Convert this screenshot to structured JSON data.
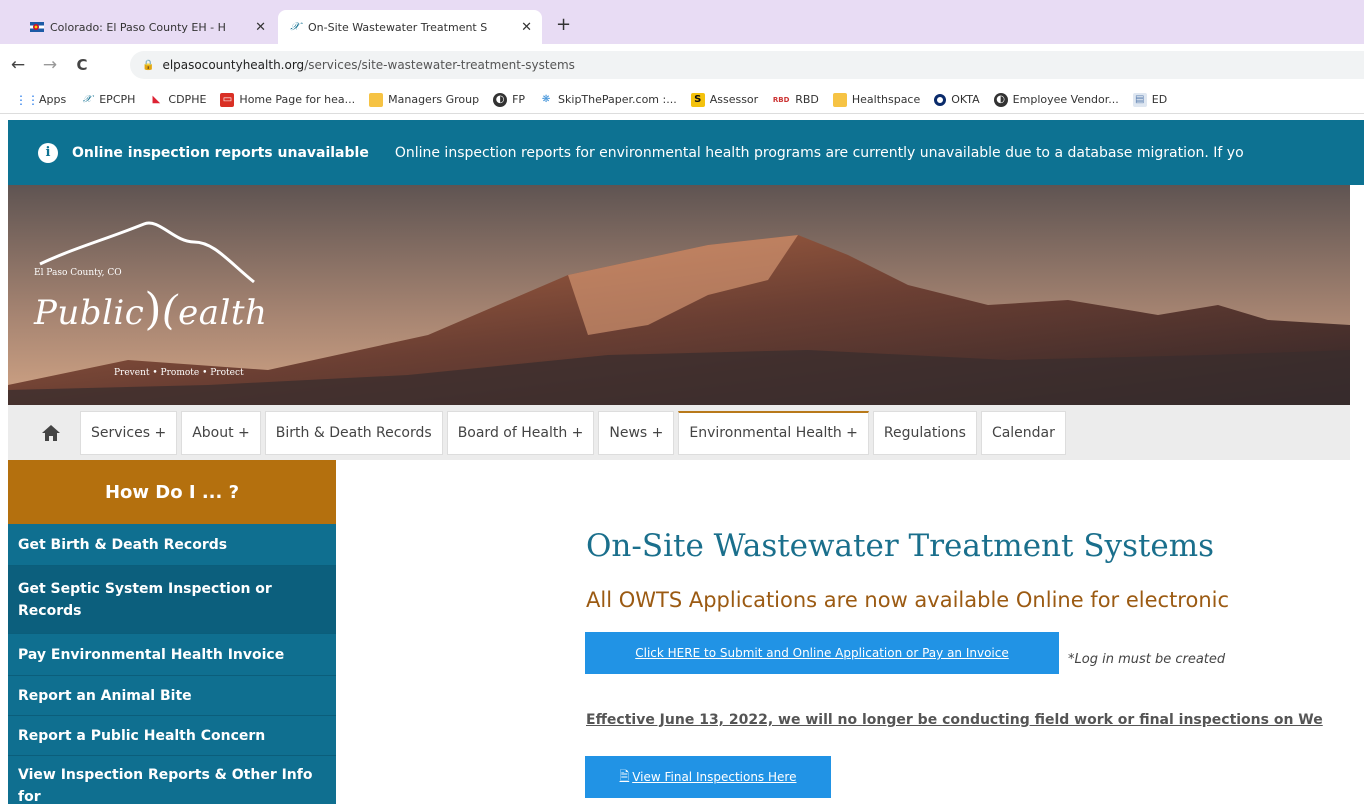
{
  "browser": {
    "tabs": [
      {
        "title": "Colorado: El Paso County EH - H"
      },
      {
        "title": "On-Site Wastewater Treatment S"
      }
    ],
    "new_tab": "+",
    "nav": {
      "back": "←",
      "forward": "→",
      "reload": "C"
    },
    "url_host": "elpasocountyhealth.org",
    "url_path": "/services/site-wastewater-treatment-systems",
    "bookmarks": [
      "Apps",
      "EPCPH",
      "CDPHE",
      "Home Page for hea...",
      "Managers Group",
      "FP",
      "SkipThePaper.com :...",
      "Assessor",
      "RBD",
      "Healthspace",
      "OKTA",
      "Employee Vendor...",
      "ED"
    ]
  },
  "alert": {
    "title": "Online inspection reports unavailable",
    "text": "Online inspection reports for environmental health programs are currently unavailable due to a database migration. If yo"
  },
  "logo": {
    "county": "El Paso County, CO",
    "wordmark": "Public",
    "wordmark2": "ealth",
    "tagline": "Prevent • Promote • Protect"
  },
  "nav": {
    "items": [
      "Services +",
      "About +",
      "Birth & Death Records",
      "Board of Health +",
      "News +",
      "Environmental Health +",
      "Regulations",
      "Calendar"
    ]
  },
  "sidebar": {
    "heading": "How Do I ... ?",
    "items": [
      "Get Birth & Death Records",
      "Get Septic System Inspection or Records",
      "Pay Environmental Health Invoice",
      "Report an Animal Bite",
      "Report a Public Health Concern",
      "View Inspection Reports & Other Info for"
    ]
  },
  "content": {
    "title": "On-Site Wastewater Treatment Systems",
    "subheading": "All OWTS Applications are now available Online for electronic",
    "submit_button": "Click HERE to Submit and Online Application or Pay an Invoice",
    "login_note": "*Log in must be created",
    "effective_text": "Effective June 13, 2022, we will no longer be conducting field work or final inspections on We",
    "view_button": "View Final Inspections Here"
  },
  "colors": {
    "alert_bg": "#0d7292",
    "sidebar_bg": "#0f6f90",
    "howdo_bg": "#b4700e",
    "button_bg": "#2193e5",
    "title_color": "#1a6f8c",
    "subhead_color": "#9b5a12"
  }
}
